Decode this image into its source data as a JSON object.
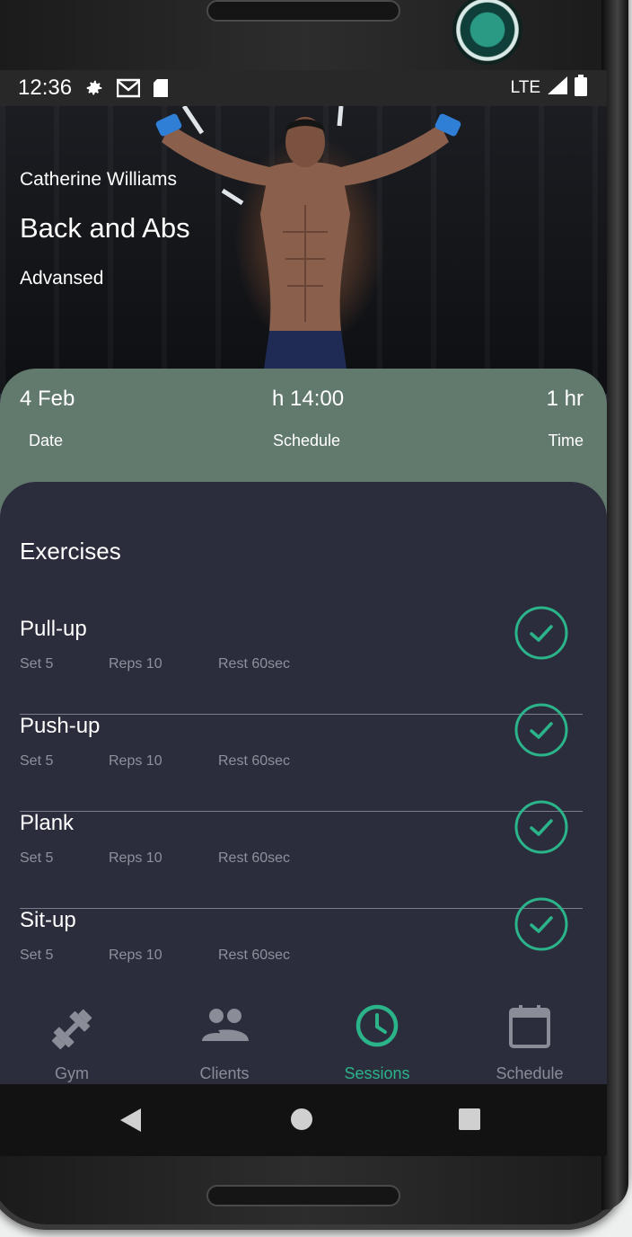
{
  "status_bar": {
    "time": "12:36",
    "network": "LTE",
    "icons": [
      "gear-icon",
      "gmail-icon",
      "sd-card-icon",
      "signal-icon",
      "battery-icon"
    ]
  },
  "hero": {
    "trainer": "Catherine Williams",
    "title": "Back and Abs",
    "level": "Advansed"
  },
  "session_info": {
    "date_value": "4 Feb",
    "date_label": "Date",
    "schedule_value": "h 14:00",
    "schedule_label": "Schedule",
    "time_value": "1 hr",
    "time_label": "Time"
  },
  "exercises": {
    "heading": "Exercises",
    "items": [
      {
        "name": "Pull-up",
        "set": "Set 5",
        "reps": "Reps 10",
        "rest": "Rest 60sec",
        "completed": true
      },
      {
        "name": "Push-up",
        "set": "Set 5",
        "reps": "Reps 10",
        "rest": "Rest 60sec",
        "completed": true
      },
      {
        "name": "Plank",
        "set": "Set 5",
        "reps": "Reps 10",
        "rest": "Rest 60sec",
        "completed": true
      },
      {
        "name": "Sit-up",
        "set": "Set 5",
        "reps": "Reps 10",
        "rest": "Rest 60sec",
        "completed": true
      }
    ]
  },
  "bottom_nav": {
    "active": "Sessions",
    "items": [
      {
        "label": "Gym",
        "icon": "dumbbell-icon"
      },
      {
        "label": "Clients",
        "icon": "people-icon"
      },
      {
        "label": "Sessions",
        "icon": "clock-icon"
      },
      {
        "label": "Schedule",
        "icon": "calendar-icon"
      }
    ]
  },
  "colors": {
    "accent": "#2bb48a",
    "info_panel": "#627a6e",
    "background": "#2b2d3c",
    "muted_text": "#8e909c"
  }
}
